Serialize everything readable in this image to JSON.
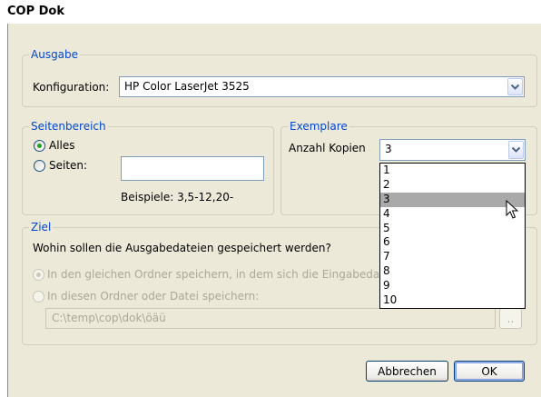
{
  "window": {
    "title": "COP Dok"
  },
  "ausgabe": {
    "legend": "Ausgabe",
    "konfiguration_label": "Konfiguration:",
    "konfiguration_value": "HP Color LaserJet 3525"
  },
  "seitenbereich": {
    "legend": "Seitenbereich",
    "alles_label": "Alles",
    "seiten_label": "Seiten:",
    "seiten_value": "",
    "beispiele": "Beispiele: 3,5-12,20-",
    "selected": "Alles"
  },
  "exemplare": {
    "legend": "Exemplare",
    "anzahl_label": "Anzahl Kopien",
    "anzahl_value": "3",
    "options": [
      "1",
      "2",
      "3",
      "4",
      "5",
      "6",
      "7",
      "8",
      "9",
      "10"
    ],
    "highlighted": "3"
  },
  "ziel": {
    "legend": "Ziel",
    "question": "Wohin sollen die Ausgabedateien gespeichert werden?",
    "option1": "In den gleichen Ordner speichern, in dem sich die Eingabedate",
    "option2": "In diesen Ordner oder Datei speichern:",
    "path_value": "C:\\temp\\cop\\dok\\öäü",
    "browse_label": ".."
  },
  "buttons": {
    "cancel": "Abbrechen",
    "ok": "OK"
  },
  "colors": {
    "legend": "#0046d5",
    "group_border": "#d0d0bf",
    "dialog_bg": "#ece9d8",
    "highlight": "#a9a9a9"
  }
}
